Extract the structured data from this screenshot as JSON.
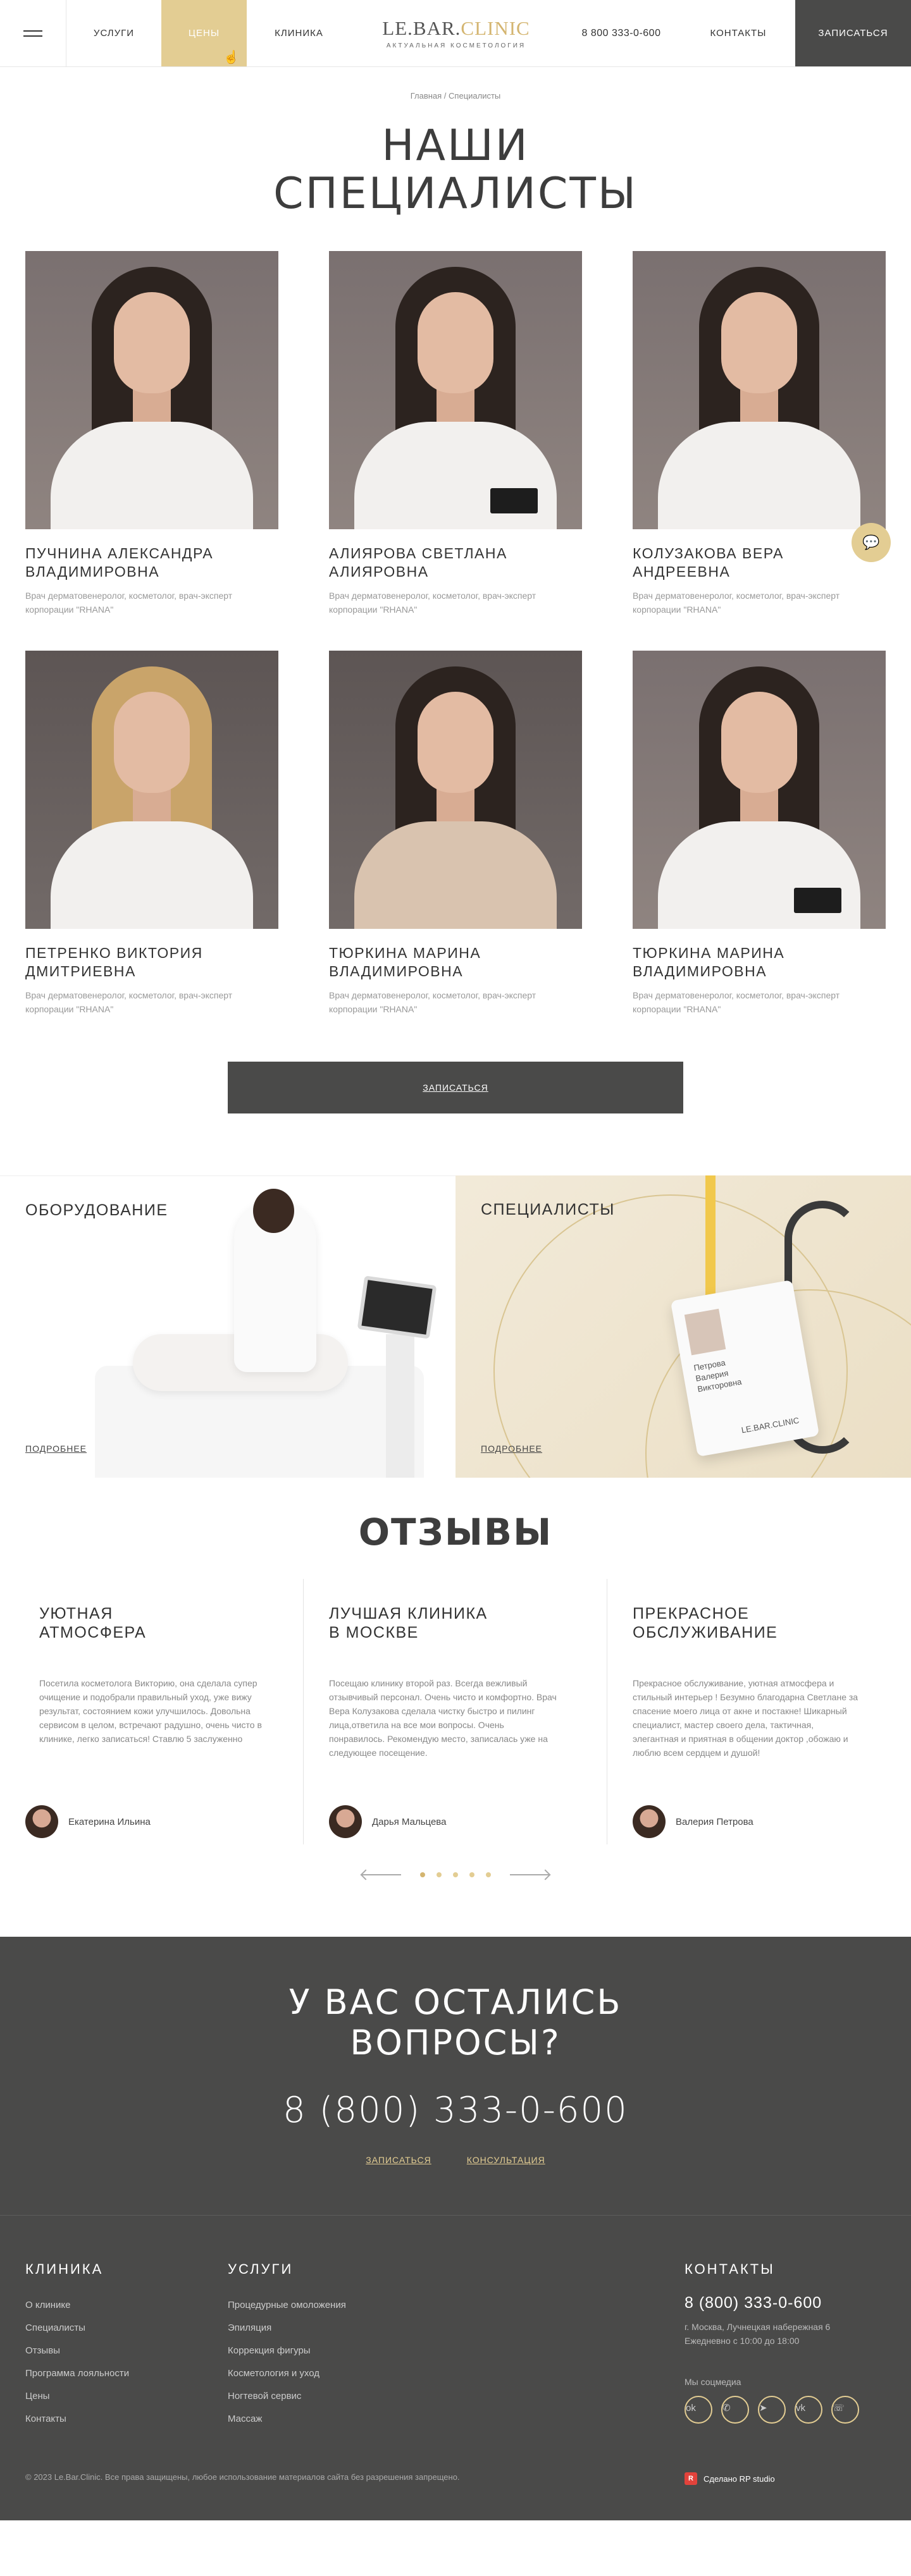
{
  "header": {
    "nav_services": "Услуги",
    "nav_prices": "Цены",
    "nav_clinic": "Клиника",
    "logo_part1": "LE.BAR.",
    "logo_part2": "CLINIC",
    "logo_sub": "Актуальная косметология",
    "phone": "8 800 333-0-600",
    "nav_contacts": "Контакты",
    "book_button": "Записаться"
  },
  "breadcrumb": "Главная / Специалисты",
  "page_title_line1": "Наши",
  "page_title_line2": "специалисты",
  "specialists": [
    {
      "name": "Пучнина Александра Владимировна",
      "role": "Врач дерматовенеролог, косметолог, врач-эксперт корпорации \"RHANA\""
    },
    {
      "name": "Алиярова Светлана Алияровна",
      "role": "Врач дерматовенеролог, косметолог, врач-эксперт корпорации \"RHANA\""
    },
    {
      "name": "Колузакова Вера Андреевна",
      "role": "Врач дерматовенеролог, косметолог, врач-эксперт корпорации \"RHANA\""
    },
    {
      "name": "Петренко Виктория Дмитриевна",
      "role": "Врач дерматовенеролог, косметолог, врач-эксперт корпорации \"RHANA\""
    },
    {
      "name": "Тюркина Марина Владимировна",
      "role": "Врач дерматовенеролог, косметолог, врач-эксперт корпорации \"RHANA\""
    },
    {
      "name": "Тюркина Марина Владимировна",
      "role": "Врач дерматовенеролог, косметолог, врач-эксперт корпорации \"RHANA\""
    }
  ],
  "book_wide": "Записаться",
  "promos": {
    "equipment_title": "Оборудование",
    "equipment_link": "Подробнее",
    "specialists_title": "Специалисты",
    "specialists_link": "Подробнее",
    "badge_name": "Петрова Валерия Викторовна",
    "badge_logo": "LE.BAR.CLINIC"
  },
  "reviews_title": "Отзывы",
  "reviews": [
    {
      "title1": "Уютная",
      "title2": "атмосфера",
      "text": "Посетила косметолога Викторию, она сделала супер очищение и подобрали правильный уход, уже вижу результат, состоянием кожи улучшилось. Довольна сервисом в целом, встречают радушно, очень чисто в клинике, легко записаться! Ставлю 5 заслуженно",
      "author": "Екатерина Ильина"
    },
    {
      "title1": "Лучшая клиника",
      "title2": "в Москве",
      "text": "Посещаю клинику второй раз. Всегда вежливый отзывчивый персонал. Очень чисто и комфортно. Врач Вера Колузакова сделала чистку быстро и пилинг лица,ответила на все мои вопросы. Очень понравилось. Рекомендую место, записалась уже на следующее посещение.",
      "author": "Дарья Мальцева"
    },
    {
      "title1": "Прекрасное",
      "title2": "обслуживание",
      "text": "Прекрасное обслуживание, уютная атмосфера и стильный интерьер ! Безумно благодарна Светлане за спасение моего лица от акне и постакне! Шикарный специалист, мастер своего дела, тактичная, элегантная и приятная в общении доктор ,обожаю и люблю всем сердцем и душой!",
      "author": "Валерия Петрова"
    }
  ],
  "cta": {
    "title_line1": "У вас остались",
    "title_line2": "вопросы?",
    "phone": "8 (800) 333-0-600",
    "link_book": "Записаться",
    "link_consult": "Консультация"
  },
  "footer": {
    "clinic_heading": "Клиника",
    "clinic_links": [
      "О клинике",
      "Специалисты",
      "Отзывы",
      "Программа лояльности",
      "Цены",
      "Контакты"
    ],
    "services_heading": "Услуги",
    "services_links": [
      "Процедурные омоложения",
      "Эпиляция",
      "Коррекция фигуры",
      "Косметология и уход",
      "Ногтевой сервис",
      "Массаж"
    ],
    "contacts_heading": "Контакты",
    "phone": "8 (800) 333-0-600",
    "address": "г. Москва, Лучнецкая набережная 6",
    "hours": "Ежедневно с 10:00 до 18:00",
    "social_label": "Мы соцмедиа",
    "copyright": "© 2023 Le.Bar.Clinic. Все права защищены, любое использование материалов сайта без разрешения запрещено.",
    "made_by": "Сделано RP studio"
  },
  "colors": {
    "accent": "#e3cd93",
    "dark": "#4a4a49"
  }
}
